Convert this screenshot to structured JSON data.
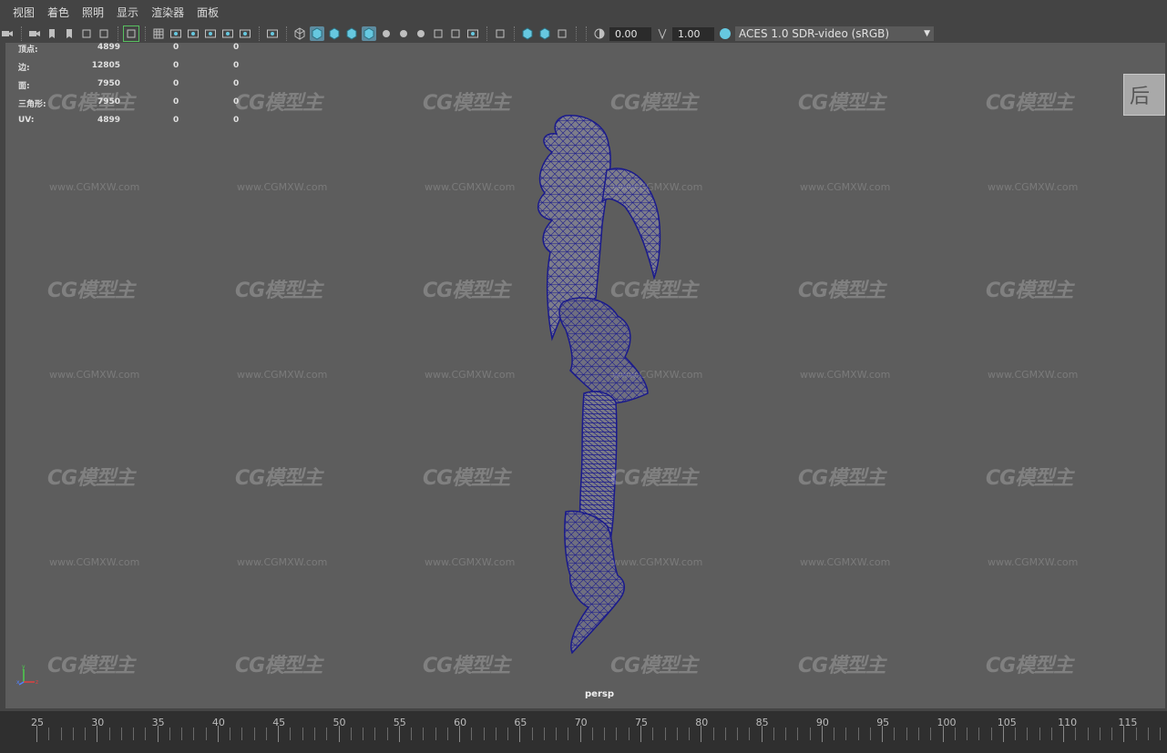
{
  "menubar": {
    "items": [
      "视图",
      "着色",
      "照明",
      "显示",
      "渲染器",
      "面板"
    ]
  },
  "toolbar": {
    "icons": [
      "camera-icon",
      "camera-attr-icon",
      "bookmark-icon",
      "bookmark-add-icon",
      "image-plane-icon",
      "2d-pan-icon",
      "grease-pencil-icon",
      "grid-icon",
      "film-gate-icon",
      "resolution-gate-icon",
      "gate-mask-icon",
      "field-chart-icon",
      "safe-action-icon",
      "safe-title-icon",
      "wireframe-icon",
      "smooth-shade-icon",
      "default-material-icon",
      "xray-icon",
      "textured-icon",
      "lights-icon",
      "shadows-icon",
      "ambient-occlusion-icon",
      "motion-blur-icon",
      "antialias-icon",
      "depth-of-field-icon",
      "isolate-select-icon",
      "xray-joints-icon",
      "xray-active-icon",
      "backface-icon",
      "exposure-icon",
      "gamma-icon",
      "color-management-icon"
    ],
    "exposure_value": "0.00",
    "gamma_value": "1.00",
    "color_space": "ACES 1.0 SDR-video (sRGB)"
  },
  "hud": {
    "rows": [
      {
        "label": "顶点:",
        "v1": "4899",
        "v2": "0",
        "v3": "0"
      },
      {
        "label": "边:",
        "v1": "12805",
        "v2": "0",
        "v3": "0"
      },
      {
        "label": "面:",
        "v1": "7950",
        "v2": "0",
        "v3": "0"
      },
      {
        "label": "三角形:",
        "v1": "7950",
        "v2": "0",
        "v3": "0"
      },
      {
        "label": "UV:",
        "v1": "4899",
        "v2": "0",
        "v3": "0"
      }
    ]
  },
  "viewport": {
    "camera": "persp",
    "viewcube_label": "后",
    "model_wire_color": "#1a1a8c"
  },
  "watermark": {
    "logo": "CG模型主",
    "url": "www.CGMXW.com"
  },
  "timeline": {
    "labels": [
      "25",
      "30",
      "35",
      "40",
      "45",
      "50",
      "55",
      "60",
      "65",
      "70",
      "75",
      "80",
      "85",
      "90",
      "95",
      "100",
      "105",
      "110",
      "115"
    ]
  }
}
